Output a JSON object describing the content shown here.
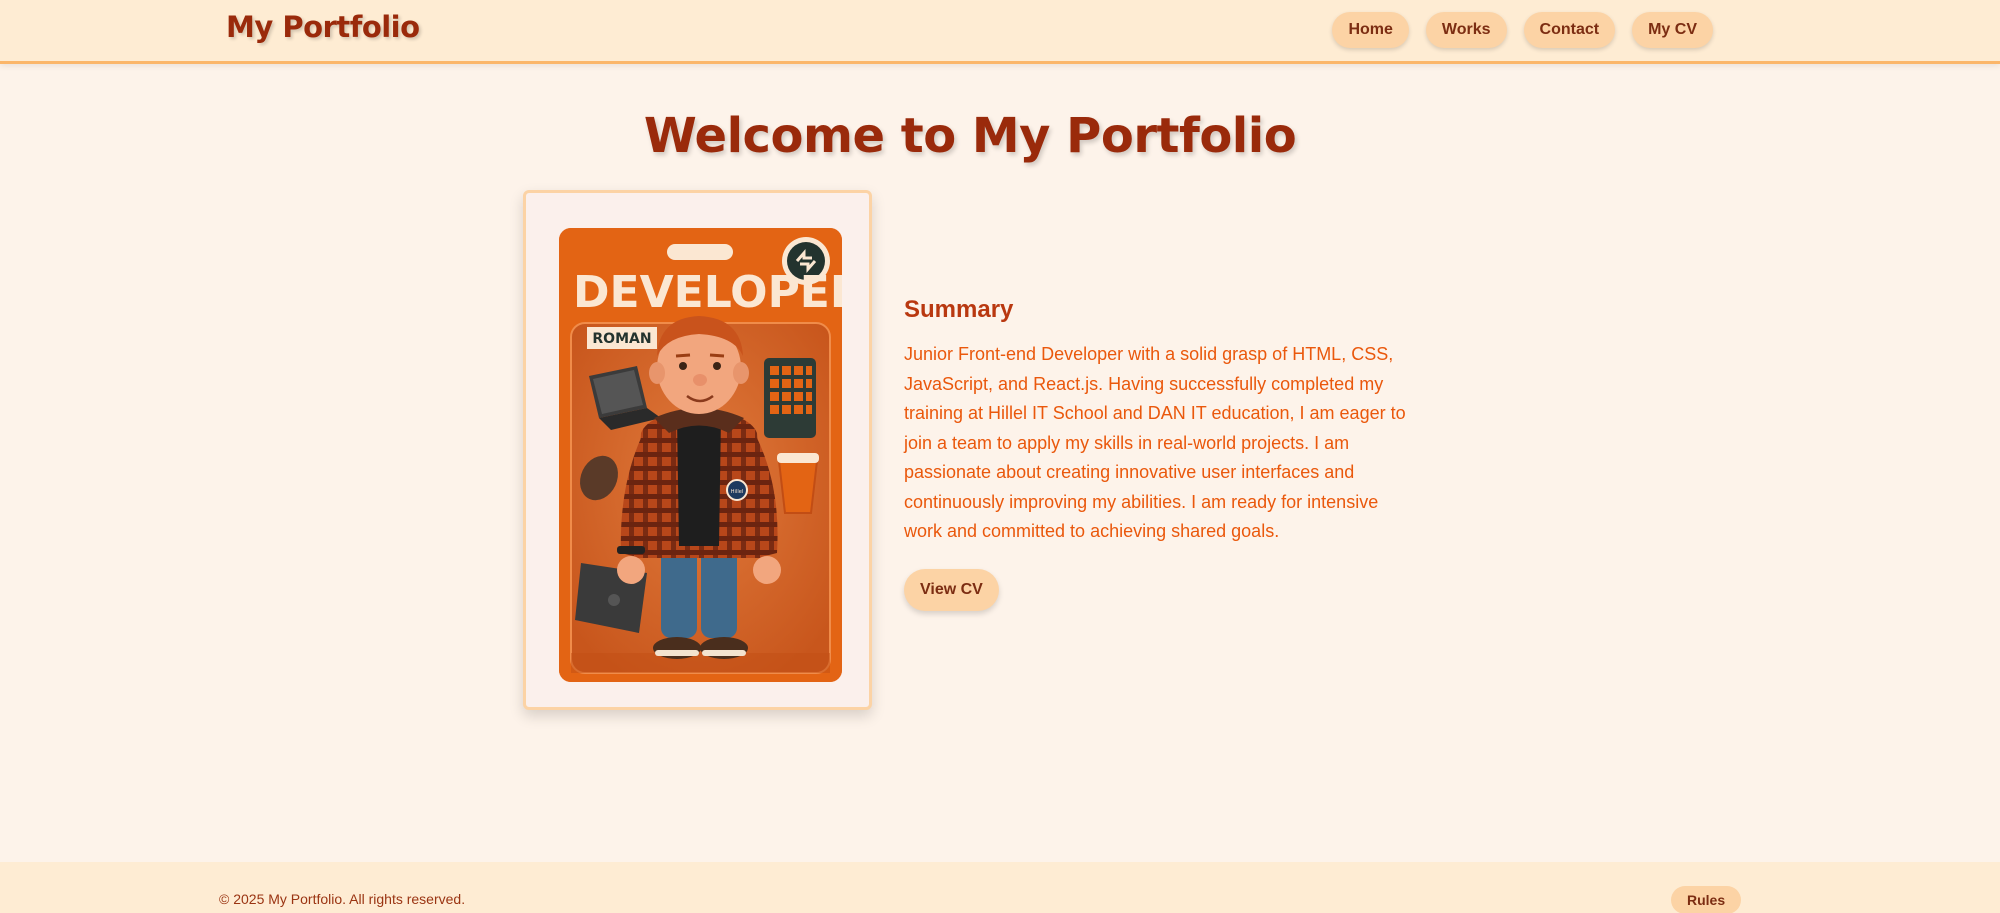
{
  "header": {
    "logo": "My Portfolio",
    "nav": [
      "Home",
      "Works",
      "Contact",
      "My CV"
    ]
  },
  "main": {
    "title": "Welcome to My Portfolio",
    "photo": {
      "card_title": "DEVELOPER",
      "name_tag": "ROMAN",
      "badge_text": "Hillel"
    },
    "summary_heading": "Summary",
    "summary_text": "Junior Front-end Developer with a solid grasp of HTML, CSS, JavaScript, and React.js. Having successfully completed my training at Hillel IT School and DAN IT education, I am eager to join a team to apply my skills in real-world projects. I am passionate about creating innovative user interfaces and continuously improving my abilities. I am ready for intensive work and committed to achieving shared goals.",
    "cv_button": "View CV"
  },
  "footer": {
    "copyright": "© 2025 My Portfolio. All rights reserved.",
    "rules_button": "Rules"
  }
}
